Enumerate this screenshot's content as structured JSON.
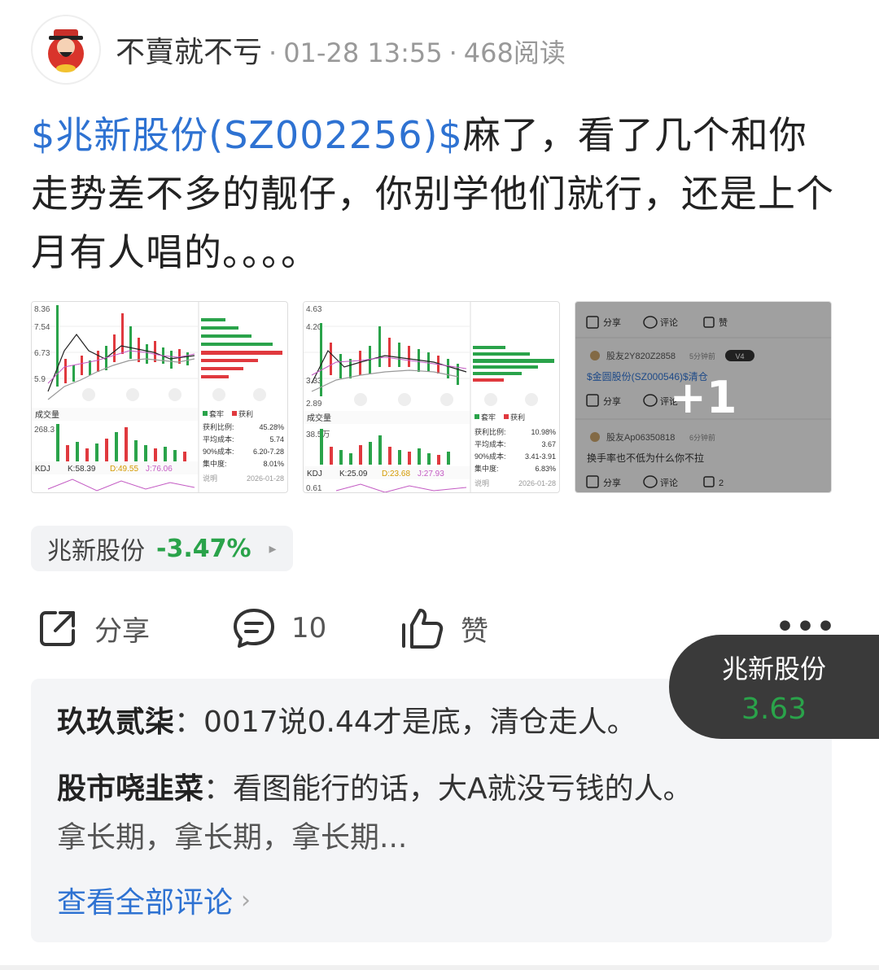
{
  "header": {
    "author": "不賣就不亏",
    "time": "01-28 13:55",
    "reads": "468阅读",
    "separator": "·"
  },
  "post": {
    "stock_link": "$兆新股份(SZ002256)$",
    "text": "麻了，看了几个和你走势差不多的靓仔，你别学他们就行，还是上个月有人唱的。。。。"
  },
  "thumb1": {
    "y_ticks": [
      "8.36",
      "7.54",
      "6.73",
      "5.9"
    ],
    "vol_label": "成交量",
    "vol_value": "268.3",
    "kdj": "KDJ",
    "k": "K:58.39",
    "d": "D:49.55",
    "j": "J:76.06",
    "legend_a": "套牢",
    "legend_b": "获利",
    "stat_labels": [
      "获利比例:",
      "平均成本:",
      "90%成本:",
      "集中度:"
    ],
    "stat_values": [
      "45.28%",
      "5.74",
      "6.20-7.28",
      "8.01%"
    ],
    "note": "说明",
    "date": "2026-01-28"
  },
  "thumb2": {
    "y_ticks": [
      "4.63",
      "4.20",
      "3.33",
      "2.89"
    ],
    "vol_label": "成交量",
    "vol_value": "38.5万",
    "kdj": "KDJ",
    "k": "K:25.09",
    "d": "D:23.68",
    "j": "J:27.93",
    "bottom": "0.61",
    "legend_a": "套牢",
    "legend_b": "获利",
    "stat_labels": [
      "获利比例:",
      "平均成本:",
      "90%成本:",
      "集中度:"
    ],
    "stat_values": [
      "10.98%",
      "3.67",
      "3.41-3.91",
      "6.83%"
    ],
    "note": "说明",
    "date": "2026-01-28"
  },
  "thumb3": {
    "share": "分享",
    "comment": "评论",
    "like": "赞",
    "user1": "股友2Y820Z2858",
    "user1_time": "5分钟前",
    "user1_badge": "V4",
    "user1_text": "$金圆股份(SZ000546)$清仓",
    "user2": "股友Ap06350818",
    "user2_time": "6分钟前",
    "user2_text": "换手率也不低为什么你不拉",
    "like_count": "2",
    "more": "+1"
  },
  "stock_chip": {
    "name": "兆新股份",
    "change": "-3.47%",
    "arrow": "▸"
  },
  "actions": {
    "share": "分享",
    "comments": "10",
    "like": "赞",
    "more": "•••"
  },
  "comments": [
    {
      "name": "玖玖贰柒",
      "text": "：0017说0.44才是底，清仓走人。"
    },
    {
      "name": "股市哓韭菜",
      "text": "：看图能行的话，大A就没亏钱的人。",
      "text2": "拿长期，拿长期，拿长期..."
    }
  ],
  "view_all": "查看全部评论",
  "float_quote": {
    "name": "兆新股份",
    "price": "3.63"
  },
  "colors": {
    "link": "#2e72d2",
    "down": "#2aa34a",
    "up": "#e0393e"
  }
}
